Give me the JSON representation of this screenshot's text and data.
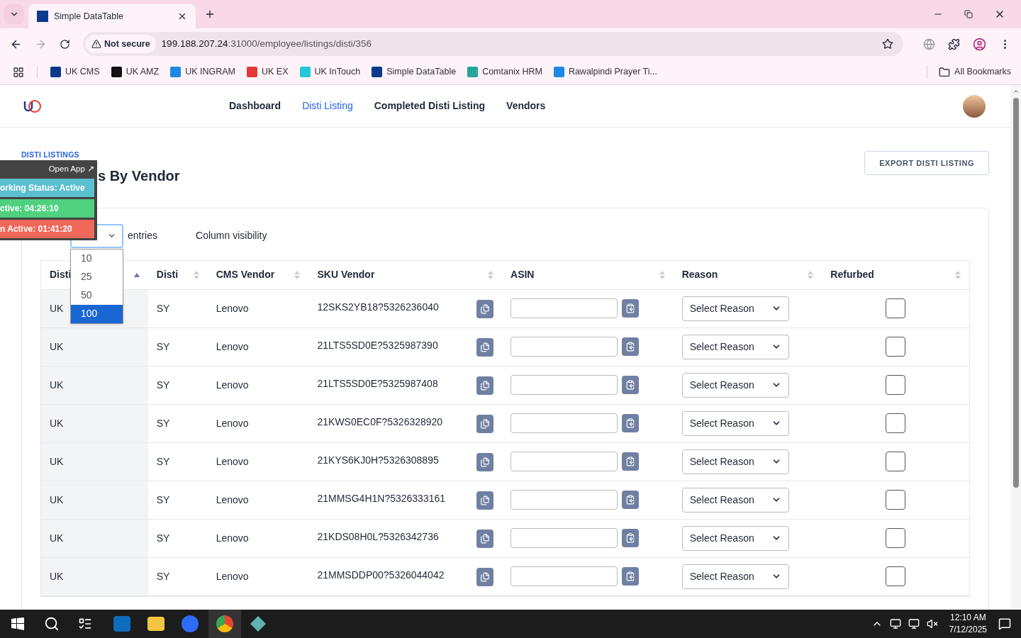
{
  "browser": {
    "tabs": [
      {
        "title": "Simple DataTable",
        "selected": true
      }
    ],
    "address": {
      "security": "Not secure",
      "host": "199.188.207.24",
      "path": ":31000/employee/listings/disti/356"
    },
    "bookmarks": [
      {
        "label": "UK CMS",
        "color": "#0b3a8c"
      },
      {
        "label": "UK AMZ",
        "color": "#111111"
      },
      {
        "label": "UK INGRAM",
        "color": "#1e88e5"
      },
      {
        "label": "UK EX",
        "color": "#e53935"
      },
      {
        "label": "UK InTouch",
        "color": "#26c6da"
      },
      {
        "label": "Simple DataTable",
        "color": "#0b3a8c"
      },
      {
        "label": "Comtanix HRM",
        "color": "#26a69a"
      },
      {
        "label": "Rawalpindi Prayer Ti...",
        "color": "#1e88e5"
      }
    ],
    "all_bookmarks": "All Bookmarks"
  },
  "nav": [
    {
      "label": "Dashboard",
      "selected": false
    },
    {
      "label": "Disti Listing",
      "selected": true
    },
    {
      "label": "Completed Disti Listing",
      "selected": false
    },
    {
      "label": "Vendors",
      "selected": false
    }
  ],
  "breadcrumb": "DISTI LISTINGS",
  "heading": "s By Vendor",
  "export_button": "EXPORT DISTI LISTING",
  "overlay": {
    "open_app": "Open App ↗",
    "statuses": [
      {
        "text": "orking Status: Active",
        "color": "#5bc0cf"
      },
      {
        "text": "ctive: 04:26:10",
        "color": "#4fd17f"
      },
      {
        "text": "n Active: 01:41:20",
        "color": "#f0685a"
      }
    ]
  },
  "length": {
    "entries": "entries",
    "options": [
      {
        "label": "10",
        "selected": false
      },
      {
        "label": "25",
        "selected": false
      },
      {
        "label": "50",
        "selected": false
      },
      {
        "label": "100",
        "selected": true
      }
    ]
  },
  "column_visibility": "Column visibility",
  "table": {
    "columns": [
      {
        "label": "Disti",
        "sorted": true
      },
      {
        "label": "Disti",
        "sorted": false
      },
      {
        "label": "CMS Vendor",
        "sorted": false
      },
      {
        "label": "SKU Vendor",
        "sorted": false
      },
      {
        "label": "ASIN",
        "sorted": false
      },
      {
        "label": "Reason",
        "sorted": false
      },
      {
        "label": "Refurbed",
        "sorted": false
      }
    ],
    "rows": [
      {
        "column_1": "UK",
        "disti": "SY",
        "cms_vendor": "Lenovo",
        "sku_vendor": "12SKS2YB18?5326236040",
        "reason": "Select Reason",
        "refurbed": false
      },
      {
        "column_1": "UK",
        "disti": "SY",
        "cms_vendor": "Lenovo",
        "sku_vendor": "21LTS5SD0E?5325987390",
        "reason": "Select Reason",
        "refurbed": false
      },
      {
        "column_1": "UK",
        "disti": "SY",
        "cms_vendor": "Lenovo",
        "sku_vendor": "21LTS5SD0E?5325987408",
        "reason": "Select Reason",
        "refurbed": false
      },
      {
        "column_1": "UK",
        "disti": "SY",
        "cms_vendor": "Lenovo",
        "sku_vendor": "21KWS0EC0F?5326328920",
        "reason": "Select Reason",
        "refurbed": false
      },
      {
        "column_1": "UK",
        "disti": "SY",
        "cms_vendor": "Lenovo",
        "sku_vendor": "21KYS6KJ0H?5326308895",
        "reason": "Select Reason",
        "refurbed": false
      },
      {
        "column_1": "UK",
        "disti": "SY",
        "cms_vendor": "Lenovo",
        "sku_vendor": "21MMSG4H1N?5326333161",
        "reason": "Select Reason",
        "refurbed": false
      },
      {
        "column_1": "UK",
        "disti": "SY",
        "cms_vendor": "Lenovo",
        "sku_vendor": "21KDS08H0L?5326342736",
        "reason": "Select Reason",
        "refurbed": false
      },
      {
        "column_1": "UK",
        "disti": "SY",
        "cms_vendor": "Lenovo",
        "sku_vendor": "21MMSDDP00?5326044042",
        "reason": "Select Reason",
        "refurbed": false
      }
    ]
  },
  "taskbar": {
    "time": "12:10 AM",
    "date": "7/12/2025"
  }
}
